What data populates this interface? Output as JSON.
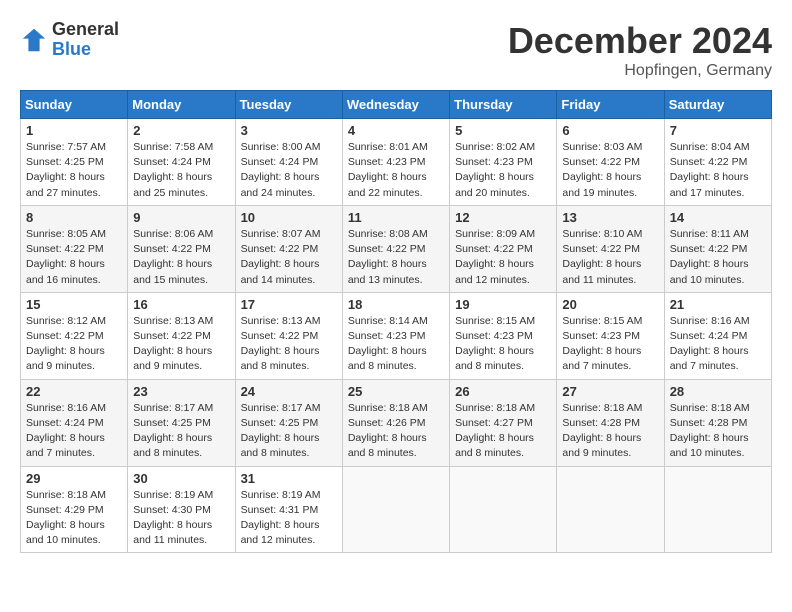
{
  "logo": {
    "general": "General",
    "blue": "Blue"
  },
  "title": {
    "month_year": "December 2024",
    "location": "Hopfingen, Germany"
  },
  "calendar": {
    "headers": [
      "Sunday",
      "Monday",
      "Tuesday",
      "Wednesday",
      "Thursday",
      "Friday",
      "Saturday"
    ],
    "weeks": [
      [
        {
          "day": "1",
          "sunrise": "7:57 AM",
          "sunset": "4:25 PM",
          "daylight": "8 hours and 27 minutes."
        },
        {
          "day": "2",
          "sunrise": "7:58 AM",
          "sunset": "4:24 PM",
          "daylight": "8 hours and 25 minutes."
        },
        {
          "day": "3",
          "sunrise": "8:00 AM",
          "sunset": "4:24 PM",
          "daylight": "8 hours and 24 minutes."
        },
        {
          "day": "4",
          "sunrise": "8:01 AM",
          "sunset": "4:23 PM",
          "daylight": "8 hours and 22 minutes."
        },
        {
          "day": "5",
          "sunrise": "8:02 AM",
          "sunset": "4:23 PM",
          "daylight": "8 hours and 20 minutes."
        },
        {
          "day": "6",
          "sunrise": "8:03 AM",
          "sunset": "4:22 PM",
          "daylight": "8 hours and 19 minutes."
        },
        {
          "day": "7",
          "sunrise": "8:04 AM",
          "sunset": "4:22 PM",
          "daylight": "8 hours and 17 minutes."
        }
      ],
      [
        {
          "day": "8",
          "sunrise": "8:05 AM",
          "sunset": "4:22 PM",
          "daylight": "8 hours and 16 minutes."
        },
        {
          "day": "9",
          "sunrise": "8:06 AM",
          "sunset": "4:22 PM",
          "daylight": "8 hours and 15 minutes."
        },
        {
          "day": "10",
          "sunrise": "8:07 AM",
          "sunset": "4:22 PM",
          "daylight": "8 hours and 14 minutes."
        },
        {
          "day": "11",
          "sunrise": "8:08 AM",
          "sunset": "4:22 PM",
          "daylight": "8 hours and 13 minutes."
        },
        {
          "day": "12",
          "sunrise": "8:09 AM",
          "sunset": "4:22 PM",
          "daylight": "8 hours and 12 minutes."
        },
        {
          "day": "13",
          "sunrise": "8:10 AM",
          "sunset": "4:22 PM",
          "daylight": "8 hours and 11 minutes."
        },
        {
          "day": "14",
          "sunrise": "8:11 AM",
          "sunset": "4:22 PM",
          "daylight": "8 hours and 10 minutes."
        }
      ],
      [
        {
          "day": "15",
          "sunrise": "8:12 AM",
          "sunset": "4:22 PM",
          "daylight": "8 hours and 9 minutes."
        },
        {
          "day": "16",
          "sunrise": "8:13 AM",
          "sunset": "4:22 PM",
          "daylight": "8 hours and 9 minutes."
        },
        {
          "day": "17",
          "sunrise": "8:13 AM",
          "sunset": "4:22 PM",
          "daylight": "8 hours and 8 minutes."
        },
        {
          "day": "18",
          "sunrise": "8:14 AM",
          "sunset": "4:23 PM",
          "daylight": "8 hours and 8 minutes."
        },
        {
          "day": "19",
          "sunrise": "8:15 AM",
          "sunset": "4:23 PM",
          "daylight": "8 hours and 8 minutes."
        },
        {
          "day": "20",
          "sunrise": "8:15 AM",
          "sunset": "4:23 PM",
          "daylight": "8 hours and 7 minutes."
        },
        {
          "day": "21",
          "sunrise": "8:16 AM",
          "sunset": "4:24 PM",
          "daylight": "8 hours and 7 minutes."
        }
      ],
      [
        {
          "day": "22",
          "sunrise": "8:16 AM",
          "sunset": "4:24 PM",
          "daylight": "8 hours and 7 minutes."
        },
        {
          "day": "23",
          "sunrise": "8:17 AM",
          "sunset": "4:25 PM",
          "daylight": "8 hours and 8 minutes."
        },
        {
          "day": "24",
          "sunrise": "8:17 AM",
          "sunset": "4:25 PM",
          "daylight": "8 hours and 8 minutes."
        },
        {
          "day": "25",
          "sunrise": "8:18 AM",
          "sunset": "4:26 PM",
          "daylight": "8 hours and 8 minutes."
        },
        {
          "day": "26",
          "sunrise": "8:18 AM",
          "sunset": "4:27 PM",
          "daylight": "8 hours and 8 minutes."
        },
        {
          "day": "27",
          "sunrise": "8:18 AM",
          "sunset": "4:28 PM",
          "daylight": "8 hours and 9 minutes."
        },
        {
          "day": "28",
          "sunrise": "8:18 AM",
          "sunset": "4:28 PM",
          "daylight": "8 hours and 10 minutes."
        }
      ],
      [
        {
          "day": "29",
          "sunrise": "8:18 AM",
          "sunset": "4:29 PM",
          "daylight": "8 hours and 10 minutes."
        },
        {
          "day": "30",
          "sunrise": "8:19 AM",
          "sunset": "4:30 PM",
          "daylight": "8 hours and 11 minutes."
        },
        {
          "day": "31",
          "sunrise": "8:19 AM",
          "sunset": "4:31 PM",
          "daylight": "8 hours and 12 minutes."
        },
        null,
        null,
        null,
        null
      ]
    ]
  }
}
